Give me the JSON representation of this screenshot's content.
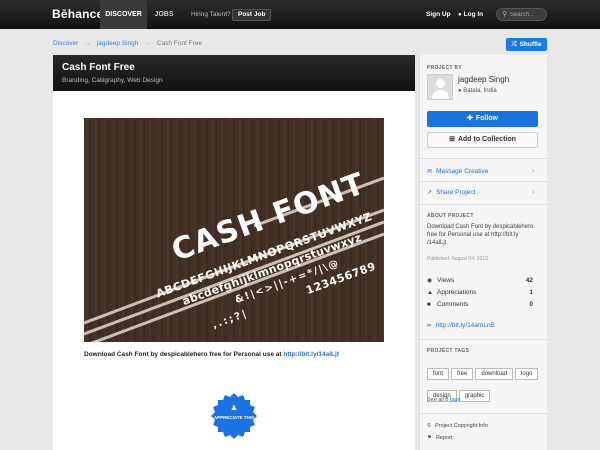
{
  "topnav": {
    "logo": "Bēhance",
    "discover": "DISCOVER",
    "jobs": "JOBS",
    "hiring": "Hiring Talent?",
    "post_job": "Post Job",
    "sign_up": "Sign Up",
    "log_in": "Log In",
    "search_placeholder": "Search..."
  },
  "breadcrumb": {
    "items": [
      "Discover",
      "jagdeep Singh",
      "Cash Font Free"
    ]
  },
  "shuffle_label": "Shuffle",
  "project": {
    "title": "Cash Font Free",
    "fields": "Branding, Calligraphy, Web Design",
    "artwork": {
      "headline": "CASH FONT",
      "upper": "ABCDEFGHIJKLMNOPQRSTUVWXYZ",
      "lower": "abcdefghijklmnopqrstuvwxyz",
      "symbols1": "&!|<>||-+=*/|\\@",
      "symbols2": ",.:;?|",
      "digits": "123456789"
    },
    "description_prefix": "Download Cash Font by despicablehero free for Personal use at ",
    "description_link": "http://bit.ly/14alLjt",
    "appreciate_label": "APPRECIATE THIS"
  },
  "sidebar": {
    "project_by_label": "PROJECT BY",
    "owner_name": "jagdeep Singh",
    "owner_location": "Batala, India",
    "follow_label": "Follow",
    "add_collection_label": "Add to Collection",
    "message_label": "Message Creative",
    "share_label": "Share Project",
    "about_label": "ABOUT PROJECT",
    "about_text": "Download Cash Font by despicablehero free for Personal use at http://bit.ly /14alLjt",
    "published": "Published: August 04, 2013",
    "stats": [
      {
        "label": "Views",
        "value": "42"
      },
      {
        "label": "Appreciations",
        "value": "1"
      },
      {
        "label": "Comments",
        "value": "0"
      }
    ],
    "short_link": "http://bit.ly/14amLnB",
    "tags_label": "PROJECT TAGS",
    "tags": [
      "font",
      "free",
      "download",
      "logo",
      "design",
      "graphic"
    ],
    "see_all_prefix": "See all ",
    "see_all_link": "8 tags",
    "copyright_label": "Project Copyright Info",
    "report_label": "Report"
  },
  "colors": {
    "accent": "#1a73e0",
    "link": "#2b6fd0",
    "topbar": "#111111"
  }
}
